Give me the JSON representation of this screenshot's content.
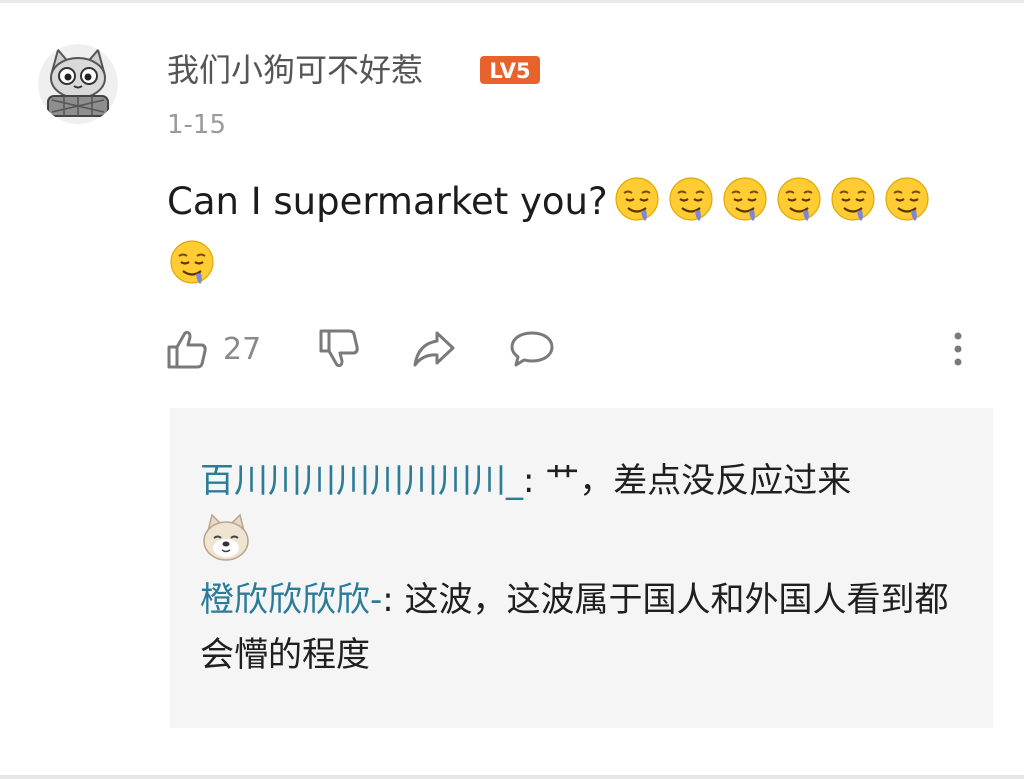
{
  "comment": {
    "username": "我们小狗可不好惹",
    "level_badge": "LV5",
    "date": "1-15",
    "text": "Can I supermarket you?",
    "emoji_name": "drooling-face-emoji",
    "emoji_count": 7,
    "avatar_caption": "卡通包装图"
  },
  "actions": {
    "like_count": "27",
    "icons": [
      "thumbs-up-icon",
      "thumbs-down-icon",
      "share-icon",
      "comment-icon",
      "more-icon"
    ]
  },
  "replies": [
    {
      "name": "百川川川川川川川川_",
      "separator": ": ",
      "text": "艹，差点没反应过来",
      "emoji_name": "shiba-dog-emoji"
    },
    {
      "name": "橙欣欣欣欣-",
      "separator": ": ",
      "text": "这波，这波属于国人和外国人看到都会懵的程度"
    }
  ],
  "colors": {
    "username": "#555555",
    "date": "#9a9a9a",
    "reply_name": "#2b7c98",
    "badge": "#e8622c",
    "reply_bg": "#f5f5f6"
  }
}
